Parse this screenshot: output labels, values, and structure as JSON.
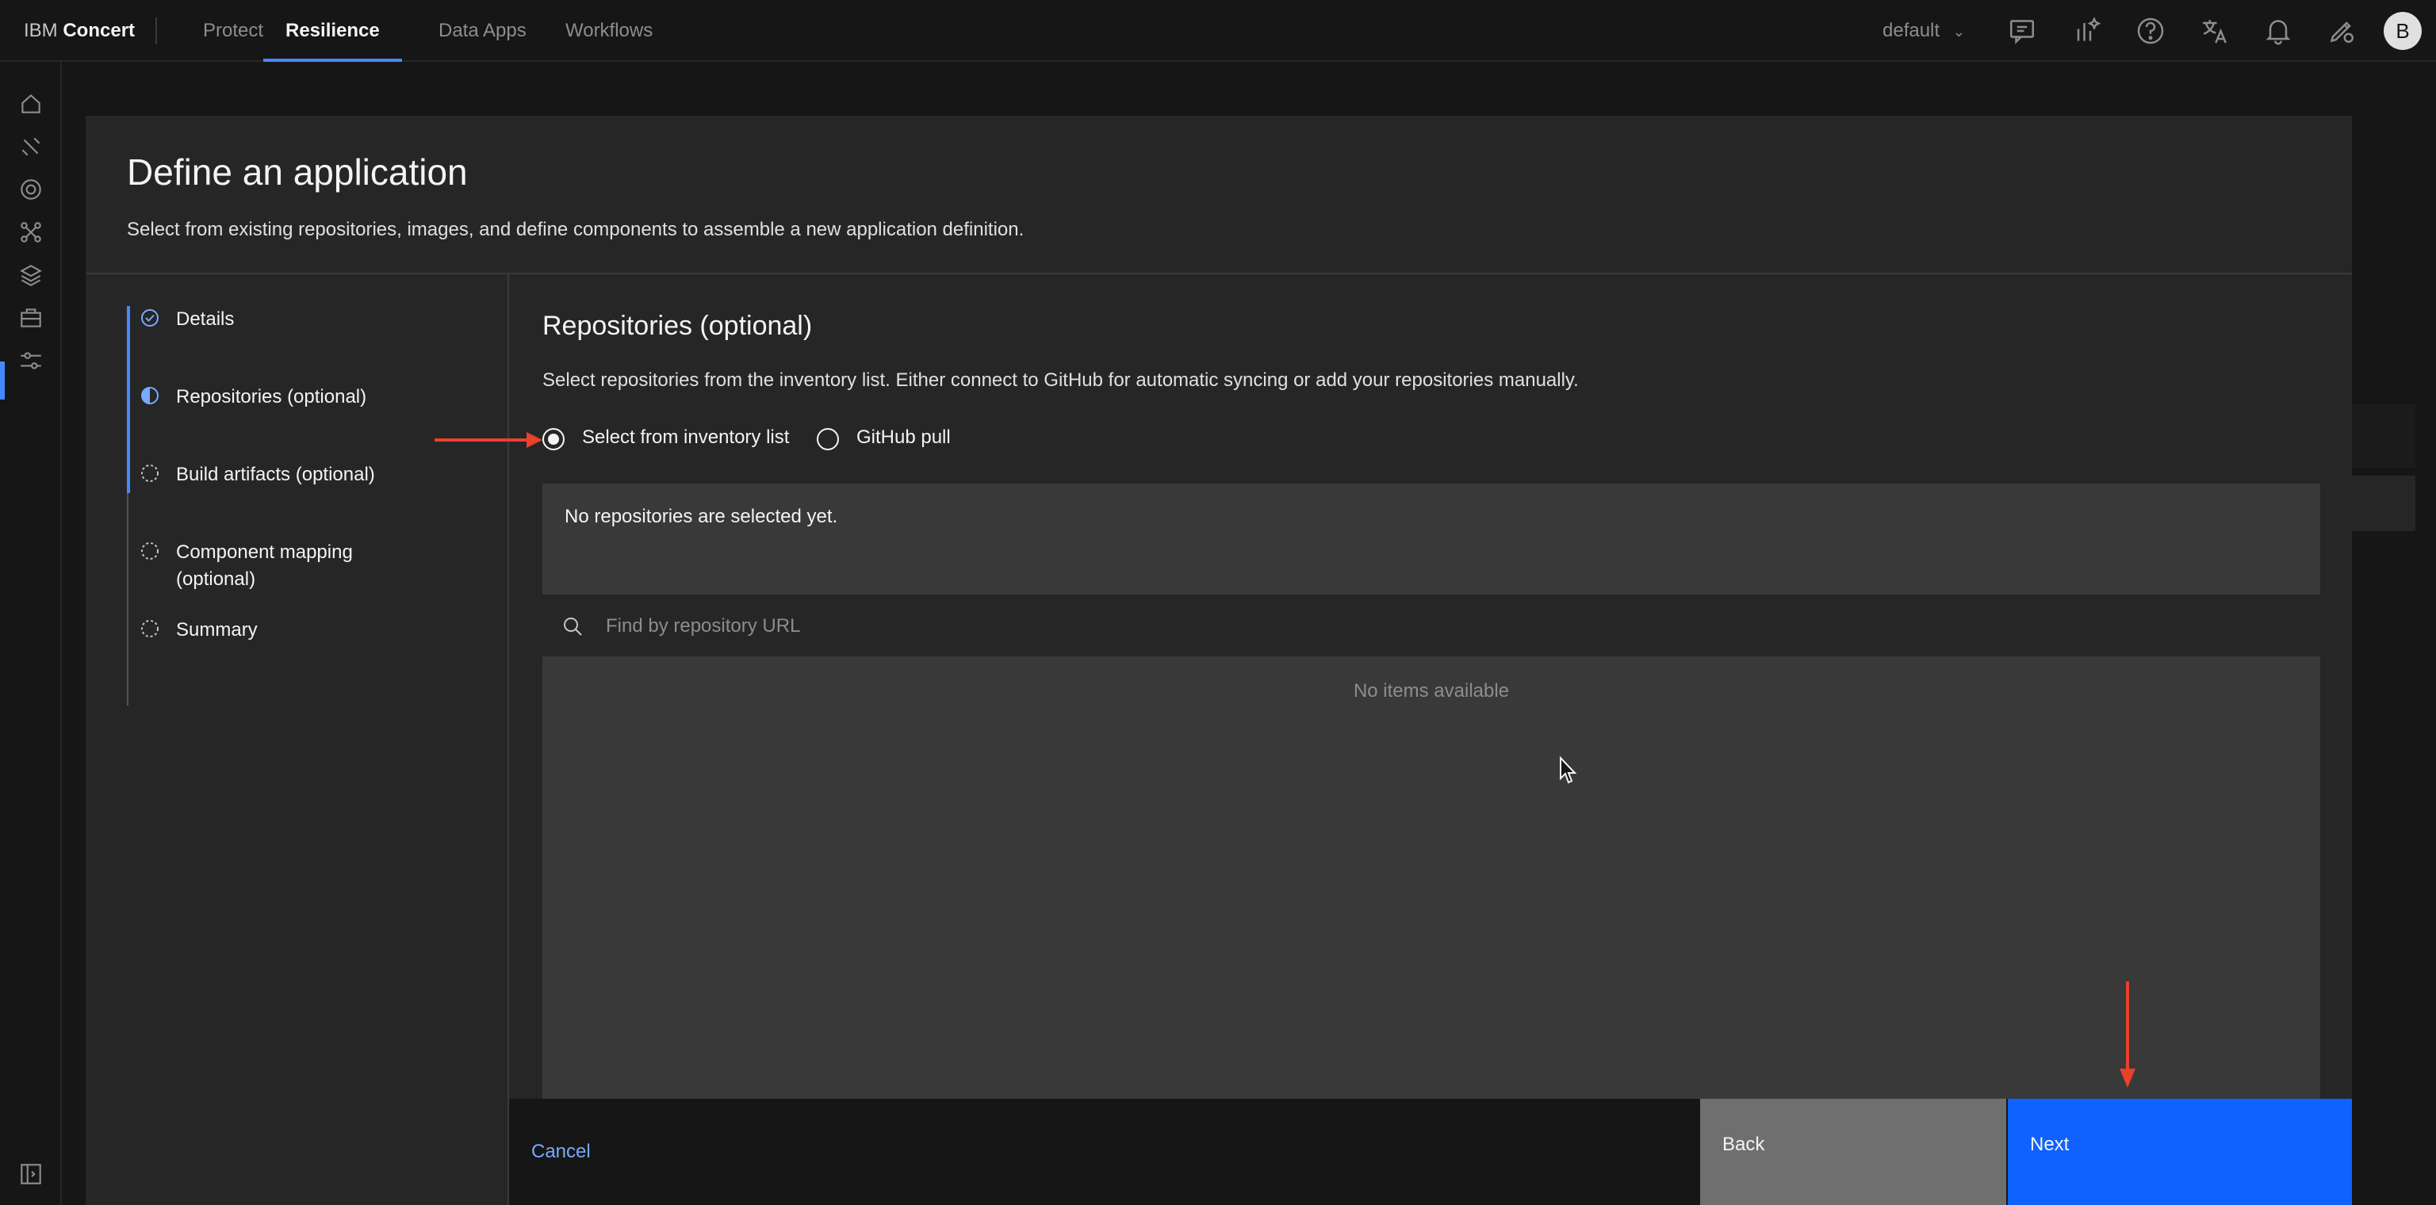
{
  "header": {
    "brand_prefix": "IBM",
    "brand_name": "Concert",
    "nav": [
      "Protect",
      "Resilience",
      "Data Apps",
      "Workflows"
    ],
    "active_nav": "Resilience",
    "tenant": "default",
    "avatar_initial": "B",
    "icons": [
      "feedback-icon",
      "ai-icon",
      "help-icon",
      "translate-icon",
      "notification-icon",
      "settings-edit-icon"
    ]
  },
  "rail": {
    "icons": [
      "home-icon",
      "tools-icon",
      "target-icon",
      "network-icon",
      "layers-icon",
      "apps-icon",
      "settings-sliders-icon",
      "panel-toggle-icon"
    ]
  },
  "modal": {
    "title": "Define an application",
    "subtitle": "Select from existing repositories, images, and define components to assemble a new application definition.",
    "steps": [
      {
        "label": "Details",
        "status": "complete"
      },
      {
        "label": "Repositories (optional)",
        "status": "current"
      },
      {
        "label": "Build artifacts (optional)",
        "status": "incomplete"
      },
      {
        "label": "Component mapping (optional)",
        "status": "incomplete"
      },
      {
        "label": "Summary",
        "status": "incomplete"
      }
    ],
    "section_title": "Repositories (optional)",
    "section_desc": "Select repositories from the inventory list. Either connect to GitHub for automatic syncing or add your repositories manually.",
    "radio_options": [
      {
        "label": "Select from inventory list",
        "selected": true
      },
      {
        "label": "GitHub pull",
        "selected": false
      }
    ],
    "selected_text": "No repositories are selected yet.",
    "search_placeholder": "Find by repository URL",
    "empty_text": "No items available",
    "cancel_label": "Cancel",
    "back_label": "Back",
    "next_label": "Next"
  },
  "colors": {
    "accent": "#0f62fe",
    "link": "#78a9ff",
    "annotation": "#e8412c"
  }
}
